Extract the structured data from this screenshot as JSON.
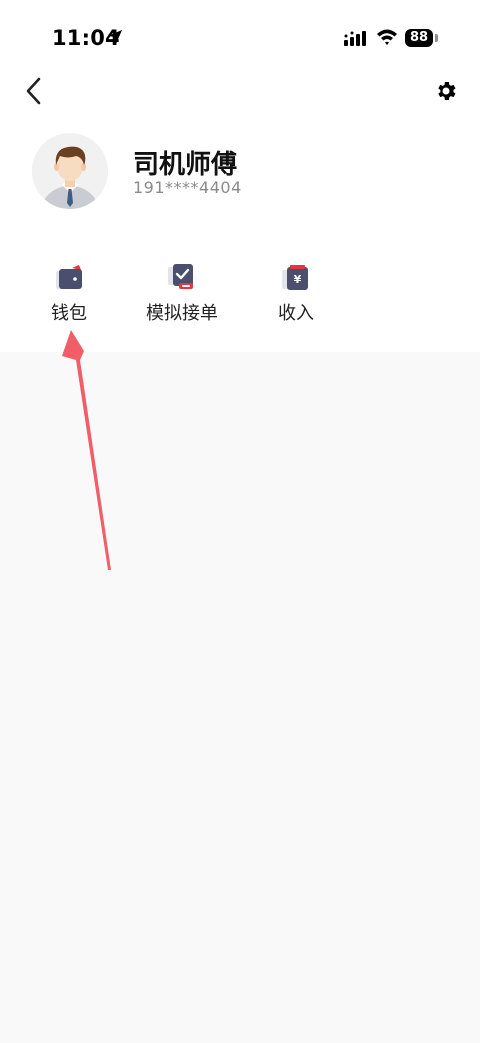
{
  "status_bar": {
    "time": "11:04",
    "battery": "88"
  },
  "profile": {
    "name": "司机师傅",
    "phone": "191****4404"
  },
  "menu": [
    {
      "label": "钱包",
      "icon": "wallet-icon"
    },
    {
      "label": "模拟接单",
      "icon": "simulate-order-icon"
    },
    {
      "label": "收入",
      "icon": "income-icon"
    }
  ],
  "colors": {
    "icon_navy": "#4a4f6d",
    "icon_red": "#e5353f",
    "annotation_arrow": "#f0505a"
  }
}
